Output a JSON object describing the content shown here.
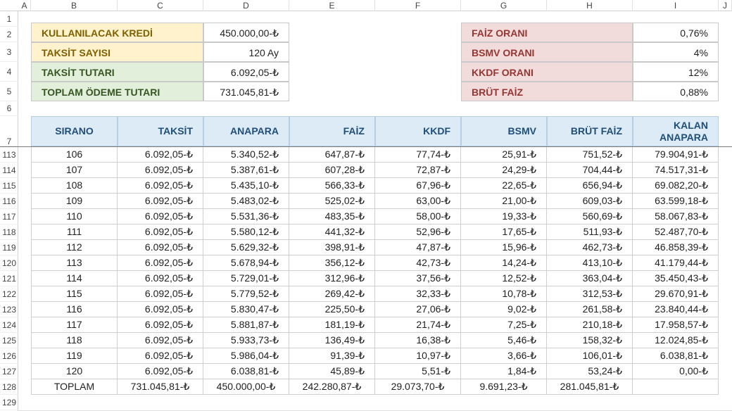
{
  "columns": [
    "A",
    "B",
    "C",
    "D",
    "E",
    "F",
    "G",
    "H",
    "I",
    "J"
  ],
  "row_numbers": [
    "1",
    "2",
    "3",
    "4",
    "5",
    "6",
    "7",
    "113",
    "114",
    "115",
    "116",
    "117",
    "118",
    "119",
    "120",
    "121",
    "122",
    "123",
    "124",
    "125",
    "126",
    "127",
    "128",
    "129"
  ],
  "left_box": [
    {
      "label": "KULLANILACAK KREDİ",
      "value": "450.000,00-₺"
    },
    {
      "label": "TAKSİT SAYISI",
      "value": "120 Ay"
    },
    {
      "label": "TAKSİT TUTARI",
      "value": "6.092,05-₺"
    },
    {
      "label": "TOPLAM ÖDEME TUTARI",
      "value": "731.045,81-₺"
    }
  ],
  "right_box": [
    {
      "label": "FAİZ ORANI",
      "value": "0,76%"
    },
    {
      "label": "BSMV ORANI",
      "value": "4%"
    },
    {
      "label": "KKDF ORANI",
      "value": "12%"
    },
    {
      "label": "BRÜT FAİZ",
      "value": "0,88%"
    }
  ],
  "table": {
    "headers": [
      "SIRANO",
      "TAKSİT",
      "ANAPARA",
      "FAİZ",
      "KKDF",
      "BSMV",
      "BRÜT FAİZ",
      "KALAN ANAPARA"
    ],
    "rows": [
      [
        "106",
        "6.092,05-₺",
        "5.340,52-₺",
        "647,87-₺",
        "77,74-₺",
        "25,91-₺",
        "751,52-₺",
        "79.904,91-₺"
      ],
      [
        "107",
        "6.092,05-₺",
        "5.387,61-₺",
        "607,28-₺",
        "72,87-₺",
        "24,29-₺",
        "704,44-₺",
        "74.517,31-₺"
      ],
      [
        "108",
        "6.092,05-₺",
        "5.435,10-₺",
        "566,33-₺",
        "67,96-₺",
        "22,65-₺",
        "656,94-₺",
        "69.082,20-₺"
      ],
      [
        "109",
        "6.092,05-₺",
        "5.483,02-₺",
        "525,02-₺",
        "63,00-₺",
        "21,00-₺",
        "609,03-₺",
        "63.599,18-₺"
      ],
      [
        "110",
        "6.092,05-₺",
        "5.531,36-₺",
        "483,35-₺",
        "58,00-₺",
        "19,33-₺",
        "560,69-₺",
        "58.067,83-₺"
      ],
      [
        "111",
        "6.092,05-₺",
        "5.580,12-₺",
        "441,32-₺",
        "52,96-₺",
        "17,65-₺",
        "511,93-₺",
        "52.487,70-₺"
      ],
      [
        "112",
        "6.092,05-₺",
        "5.629,32-₺",
        "398,91-₺",
        "47,87-₺",
        "15,96-₺",
        "462,73-₺",
        "46.858,39-₺"
      ],
      [
        "113",
        "6.092,05-₺",
        "5.678,94-₺",
        "356,12-₺",
        "42,73-₺",
        "14,24-₺",
        "413,10-₺",
        "41.179,44-₺"
      ],
      [
        "114",
        "6.092,05-₺",
        "5.729,01-₺",
        "312,96-₺",
        "37,56-₺",
        "12,52-₺",
        "363,04-₺",
        "35.450,43-₺"
      ],
      [
        "115",
        "6.092,05-₺",
        "5.779,52-₺",
        "269,42-₺",
        "32,33-₺",
        "10,78-₺",
        "312,53-₺",
        "29.670,91-₺"
      ],
      [
        "116",
        "6.092,05-₺",
        "5.830,47-₺",
        "225,50-₺",
        "27,06-₺",
        "9,02-₺",
        "261,58-₺",
        "23.840,44-₺"
      ],
      [
        "117",
        "6.092,05-₺",
        "5.881,87-₺",
        "181,19-₺",
        "21,74-₺",
        "7,25-₺",
        "210,18-₺",
        "17.958,57-₺"
      ],
      [
        "118",
        "6.092,05-₺",
        "5.933,73-₺",
        "136,49-₺",
        "16,38-₺",
        "5,46-₺",
        "158,32-₺",
        "12.024,85-₺"
      ],
      [
        "119",
        "6.092,05-₺",
        "5.986,04-₺",
        "91,39-₺",
        "10,97-₺",
        "3,66-₺",
        "106,01-₺",
        "6.038,81-₺"
      ],
      [
        "120",
        "6.092,05-₺",
        "6.038,81-₺",
        "45,89-₺",
        "5,51-₺",
        "1,84-₺",
        "53,24-₺",
        "0,00-₺"
      ]
    ],
    "total": [
      "TOPLAM",
      "731.045,81-₺",
      "450.000,00-₺",
      "242.280,87-₺",
      "29.073,70-₺",
      "9.691,23-₺",
      "281.045,81-₺",
      ""
    ]
  },
  "colors": {
    "left_label_bg_1": "#fff2cc",
    "left_label_bg_2": "#e2efda",
    "left_label_fg_1": "#7f6000",
    "left_label_fg_2": "#375623",
    "right_label_bg": "#f2dcdb",
    "right_label_fg": "#963634",
    "header_bg": "#ddebf7",
    "header_fg": "#1f4e79"
  }
}
